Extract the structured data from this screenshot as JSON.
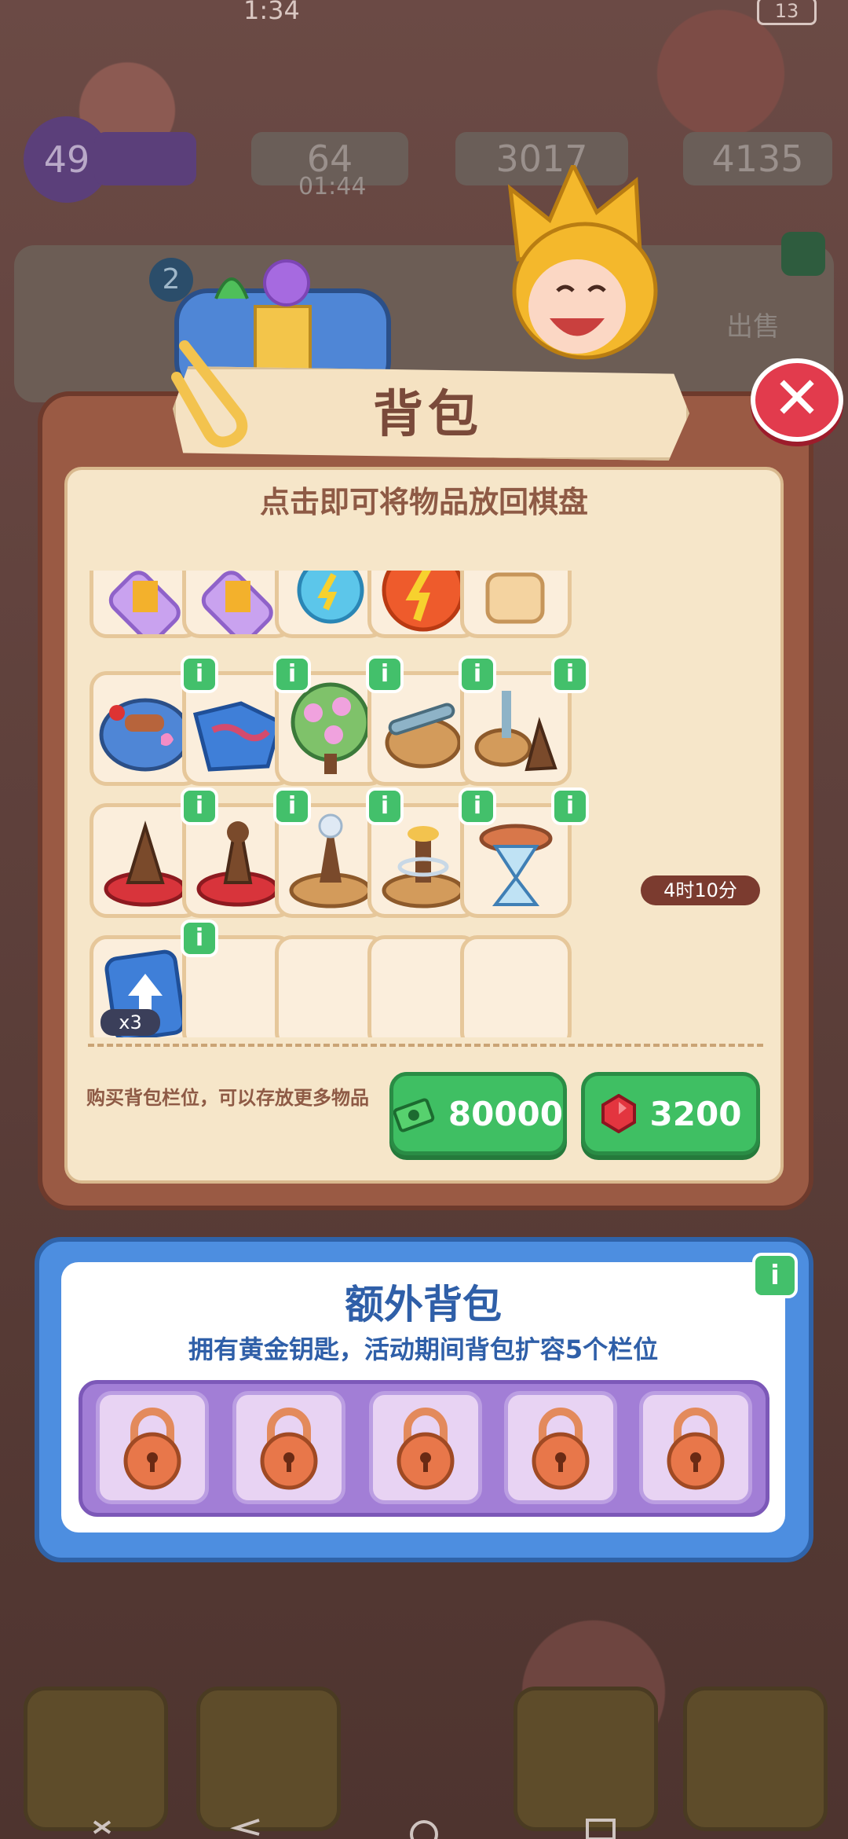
{
  "status": {
    "time": "1:34",
    "battery": "13"
  },
  "hud": {
    "level": "49",
    "energy": "64",
    "energy_timer": "01:44",
    "cash": "3017",
    "gems": "4135",
    "quest_level": "2",
    "sell_label": "出售"
  },
  "backpack": {
    "title": "背包",
    "hint": "点击即可将物品放回棋盘",
    "timer_label": "4时10分",
    "ticket_count": "x3",
    "buy_text": "购买背包栏位，可以存放更多物品",
    "buy_cash_price": "80000",
    "buy_gem_price": "3200",
    "info_glyph": "i",
    "close_glyph": "✕"
  },
  "extra": {
    "title": "额外背包",
    "subtitle": "拥有黄金钥匙，活动期间背包扩容5个栏位"
  },
  "icons": [
    "gear-icon",
    "energy-icon",
    "cash-icon",
    "gem-icon",
    "lock-icon",
    "info-icon",
    "close-icon"
  ],
  "colors": {
    "accent_green": "#3fbf63",
    "close_red": "#e23b4d",
    "extra_blue": "#4d8ee0",
    "lock_purple": "#a27ed6"
  }
}
